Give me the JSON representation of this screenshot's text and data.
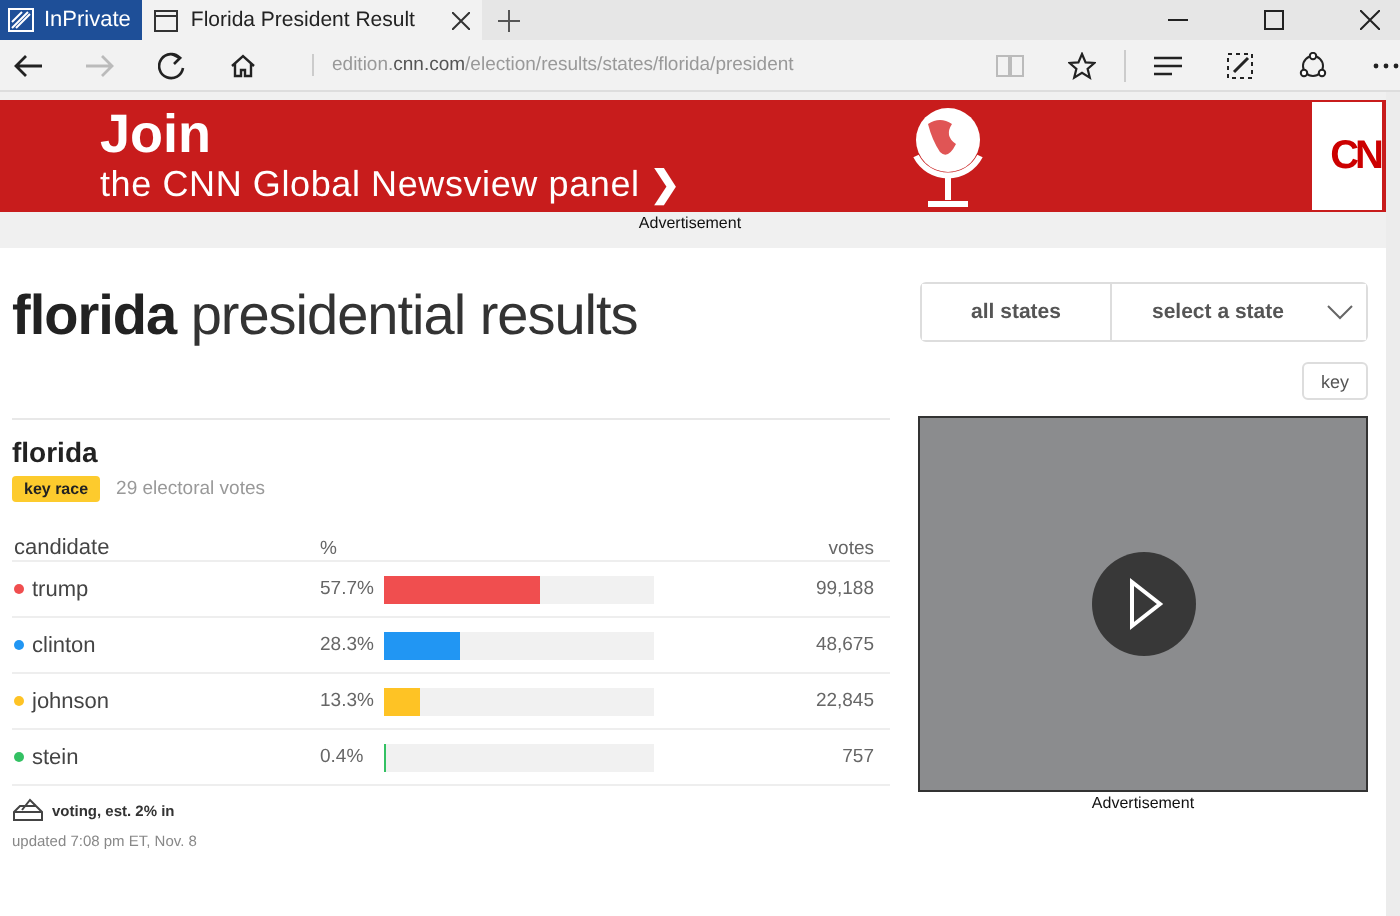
{
  "browser": {
    "private_label": "InPrivate",
    "tabs": [
      {
        "title": "Florida President Result",
        "selected": true
      }
    ],
    "address": {
      "subdomain": "edition.",
      "domain": "cnn.com",
      "path": "/election/results/states/florida/president"
    }
  },
  "banner": {
    "headline": "Join",
    "subline": "the CNN Global Newsview panel",
    "chevron": "❯",
    "logo": "CN",
    "caption": "Advertisement"
  },
  "page": {
    "state": "florida",
    "title_rest": "presidential results",
    "nav": [
      {
        "label": "all states",
        "kind": "button"
      },
      {
        "label": "select a state",
        "kind": "dropdown"
      }
    ],
    "key_button": "key"
  },
  "race": {
    "state": "florida",
    "badge": "key race",
    "electoral": "29 electoral votes",
    "columns": [
      "candidate",
      "%",
      "votes"
    ],
    "candidates": [
      {
        "name": "trump",
        "color": "#f04e4f",
        "pct": "57.7%",
        "level": 0.577,
        "votes": "99,188"
      },
      {
        "name": "clinton",
        "color": "#2196f3",
        "pct": "28.3%",
        "level": 0.283,
        "votes": "48,675"
      },
      {
        "name": "johnson",
        "color": "#fec325",
        "pct": "13.3%",
        "level": 0.133,
        "votes": "22,845"
      },
      {
        "name": "stein",
        "color": "#33c163",
        "pct": "0.4%",
        "level": 0.004,
        "votes": "757"
      }
    ],
    "status": "voting, est. 2% in",
    "updated": "updated 7:08 pm ET, Nov. 8"
  },
  "video": {
    "caption": "Advertisement"
  }
}
